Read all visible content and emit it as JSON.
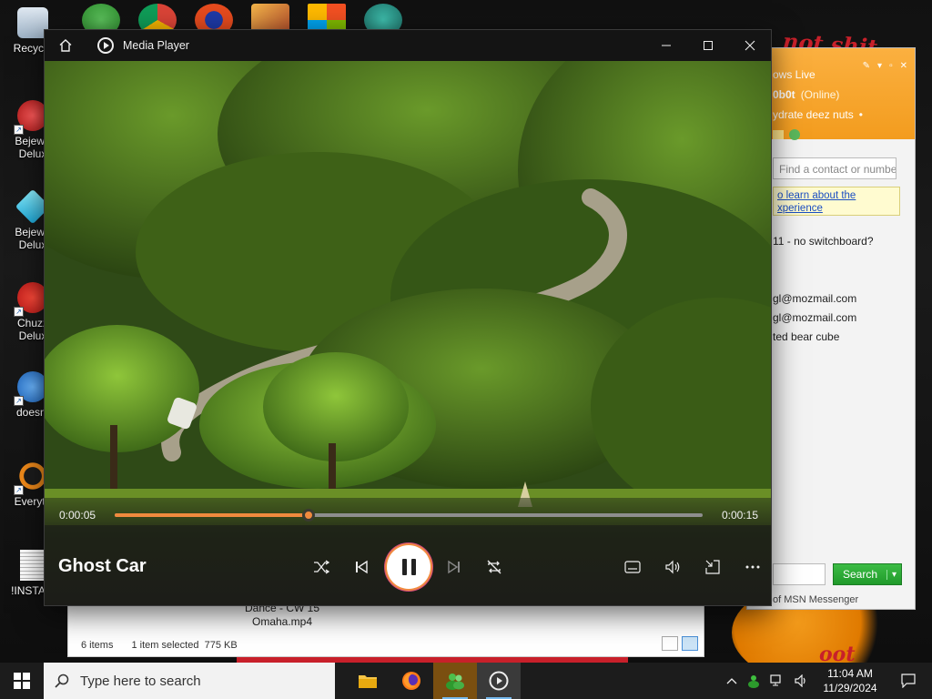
{
  "desktop": {
    "wallpaper_text_top": "not shit",
    "wallpaper_text_bottom": "oot",
    "icons": [
      {
        "label": "Recycle",
        "icon": "recycle-bin-icon"
      },
      {
        "label": "Bejewe\nDelux",
        "icon": "bejeweled-icon"
      },
      {
        "label": "Bejewe\nDelux",
        "icon": "bejeweled-diamond-icon"
      },
      {
        "label": "Chuzz\nDelux",
        "icon": "chuzzle-icon"
      },
      {
        "label": "doesnt",
        "icon": "thunderbird-icon"
      },
      {
        "label": "Everyth",
        "icon": "everything-search-icon"
      },
      {
        "label": "!INSTALI",
        "icon": "document-icon"
      }
    ]
  },
  "msn": {
    "title_fragment": "ows Live",
    "user_fragment": "0b0t",
    "status": "(Online)",
    "personal_message": "ydrate deez nuts",
    "search_placeholder": "Find a contact or numbe",
    "banner_line1": "o learn about the",
    "banner_line2": "xperience",
    "contacts": [
      "11 - no switchboard?",
      "",
      "gl@mozmail.com",
      "gl@mozmail.com",
      "ted bear cube"
    ],
    "search_button": "Search",
    "footer": "of MSN Messenger"
  },
  "explorer": {
    "file_name_line1": "Dance - CW 15",
    "file_name_line2": "Omaha.mp4",
    "item_count": "6 items",
    "selection": "1 item selected",
    "selection_size": "775 KB"
  },
  "media_player": {
    "app_title": "Media Player",
    "track_title": "Ghost Car",
    "current_time": "0:00:05",
    "duration": "0:00:15",
    "progress": 0.33,
    "accent_color": "#f08a3e"
  },
  "taskbar": {
    "search_placeholder": "Type here to search",
    "time": "11:04 AM",
    "date": "11/29/2024"
  }
}
